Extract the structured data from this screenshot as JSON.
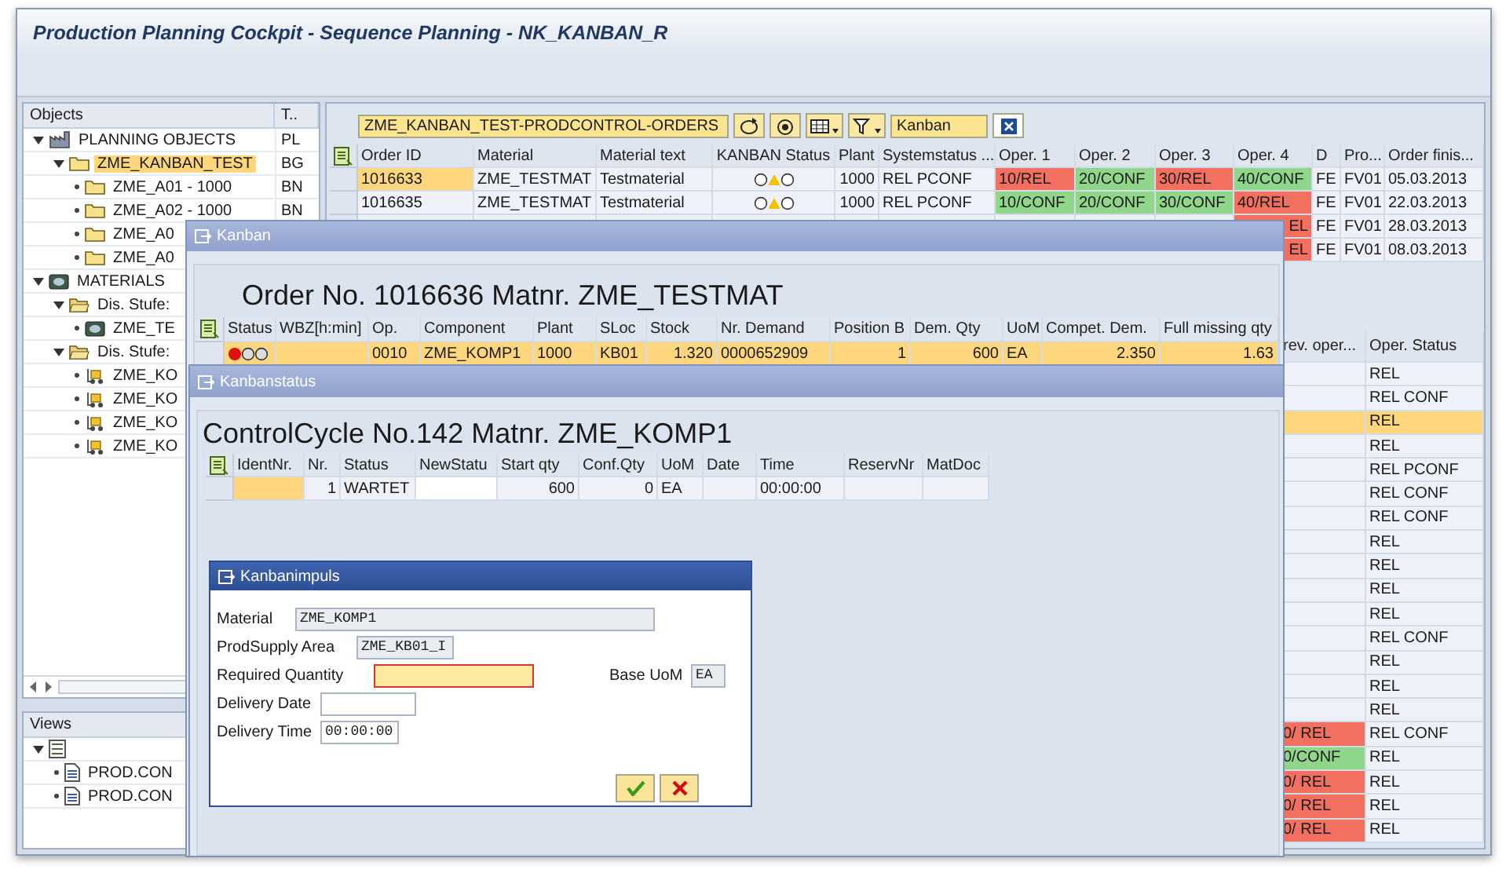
{
  "window": {
    "title": "Production Planning Cockpit - Sequence Planning - NK_KANBAN_R"
  },
  "objects_panel": {
    "columns": [
      "Objects",
      "T.."
    ],
    "tree": [
      {
        "kind": "plant",
        "label": "PLANNING OBJECTS",
        "type": "PL",
        "expanded": true,
        "selected": false,
        "children": [
          {
            "kind": "folder",
            "label": "ZME_KANBAN_TEST",
            "type": "BG",
            "expanded": true,
            "selected": true,
            "children": [
              {
                "kind": "folder",
                "label": "ZME_A01 - 1000",
                "type": "BN",
                "selected": false
              },
              {
                "kind": "folder",
                "label": "ZME_A02 - 1000",
                "type": "BN",
                "selected": false
              },
              {
                "kind": "folder",
                "label": "ZME_A0",
                "selected": false
              },
              {
                "kind": "folder",
                "label": "ZME_A0",
                "selected": false
              }
            ]
          }
        ]
      },
      {
        "kind": "material",
        "label": "MATERIALS",
        "expanded": true,
        "selected": false,
        "children": [
          {
            "kind": "open-folder",
            "label": "Dis. Stufe:",
            "expanded": true,
            "selected": false,
            "children": [
              {
                "kind": "material",
                "label": "ZME_TE",
                "selected": false
              }
            ]
          },
          {
            "kind": "open-folder",
            "label": "Dis. Stufe:",
            "expanded": true,
            "selected": false,
            "children": [
              {
                "kind": "part",
                "label": "ZME_KO",
                "selected": false
              },
              {
                "kind": "part",
                "label": "ZME_KO",
                "selected": false
              },
              {
                "kind": "part",
                "label": "ZME_KO",
                "selected": false
              },
              {
                "kind": "part",
                "label": "ZME_KO",
                "selected": false
              }
            ]
          }
        ]
      }
    ]
  },
  "views_panel": {
    "title": "Views",
    "tree": [
      {
        "kind": "list",
        "expanded": true,
        "children": [
          {
            "kind": "document",
            "label": "PROD.CON",
            "selected": false
          },
          {
            "kind": "document",
            "label": "PROD.CON",
            "selected": false
          }
        ]
      }
    ]
  },
  "orders_toolbar": {
    "variant": "ZME_KANBAN_TEST-PRODCONTROL-ORDERS",
    "layout": "Kanban"
  },
  "orders_table": {
    "columns": [
      "Order ID",
      "Material",
      "Material text",
      "KANBAN Status",
      "Plant",
      "Systemstatus ...",
      "Oper. 1",
      "Oper. 2",
      "Oper. 3",
      "Oper. 4",
      "D",
      "Pro...",
      "Order finis..."
    ],
    "rows": [
      {
        "selected": true,
        "order_id": "1016633",
        "material": "ZME_TESTMAT",
        "material_text": "Testmaterial",
        "light": {
          "kind": "yellow",
          "color": "#f2c200"
        },
        "plant": "1000",
        "system_status": "REL PCONF",
        "oper_1": {
          "text": "10/REL",
          "color": "#f2705f"
        },
        "oper_2": {
          "text": "20/CONF",
          "color": "#8fd68a"
        },
        "oper_3": {
          "text": "30/REL",
          "color": "#f2705f"
        },
        "oper_4": {
          "text": "40/CONF",
          "color": "#8fd68a"
        },
        "d": "FE",
        "pro": "FV01",
        "finish": "05.03.2013"
      },
      {
        "selected": false,
        "order_id": "1016635",
        "material": "ZME_TESTMAT",
        "material_text": "Testmaterial",
        "light": {
          "kind": "yellow",
          "color": "#f2c200"
        },
        "plant": "1000",
        "system_status": "REL PCONF",
        "oper_1": {
          "text": "10/CONF",
          "color": "#8fd68a"
        },
        "oper_2": {
          "text": "20/CONF",
          "color": "#8fd68a"
        },
        "oper_3": {
          "text": "30/CONF",
          "color": "#8fd68a"
        },
        "oper_4": {
          "text": "40/REL",
          "color": "#f2705f"
        },
        "d": "FE",
        "pro": "FV01",
        "finish": "22.03.2013"
      },
      {
        "oper_4": {
          "text": "EL",
          "color": "#f2705f"
        },
        "d": "FE",
        "pro": "FV01",
        "finish": "28.03.2013"
      },
      {
        "oper_4": {
          "text": "EL",
          "color": "#f2705f"
        },
        "d": "FE",
        "pro": "FV01",
        "finish": "08.03.2013"
      }
    ]
  },
  "operations_table": {
    "columns": [
      "rev. oper...",
      "Oper. Status"
    ],
    "rows": [
      {
        "status": "REL",
        "selected": false
      },
      {
        "status": "REL CONF",
        "selected": false
      },
      {
        "status": "REL",
        "selected": true
      },
      {
        "status": "REL",
        "selected": false
      },
      {
        "status": "REL PCONF",
        "selected": false
      },
      {
        "status": "REL CONF",
        "selected": false
      },
      {
        "status": "REL CONF",
        "selected": false
      },
      {
        "status": "REL",
        "selected": false
      },
      {
        "status": "REL",
        "selected": false
      },
      {
        "status": "REL",
        "selected": false
      },
      {
        "status": "REL",
        "selected": false
      },
      {
        "status": "REL CONF",
        "selected": false
      },
      {
        "status": "REL",
        "selected": false
      },
      {
        "status": "REL",
        "selected": false
      },
      {
        "status": "REL",
        "selected": false
      },
      {
        "prev": {
          "text": "0/ REL",
          "color": "#f2705f"
        },
        "status": "REL CONF",
        "selected": false
      },
      {
        "prev": {
          "text": "0/CONF",
          "color": "#8fd68a"
        },
        "status": "REL",
        "selected": false
      },
      {
        "prev": {
          "text": "0/ REL",
          "color": "#f2705f"
        },
        "status": "REL",
        "selected": false
      },
      {
        "prev": {
          "text": "0/ REL",
          "color": "#f2705f"
        },
        "status": "REL",
        "selected": false
      },
      {
        "prev": {
          "text": "0/ REL",
          "color": "#f2705f"
        },
        "status": "REL",
        "selected": false
      }
    ]
  },
  "kanban_dialog": {
    "title": "Kanban",
    "heading": "Order No. 1016636 Matnr. ZME_TESTMAT",
    "columns": [
      "Status",
      "WBZ[h:min]",
      "Op.",
      "Component",
      "Plant",
      "SLoc",
      "Stock",
      "Nr. Demand",
      "Position B",
      "Dem. Qty",
      "UoM",
      "Compet. Dem.",
      "Full missing qty"
    ],
    "rows": [
      {
        "selected": true,
        "light": {
          "kind": "red",
          "color": "#e01010"
        },
        "cells": [
          "",
          "",
          "0010",
          "ZME_KOMP1",
          "1000",
          "KB01",
          "1.320",
          "0000652909",
          "1",
          "600",
          "EA",
          "2.350",
          "1.63"
        ]
      }
    ]
  },
  "kanbanstatus_dialog": {
    "title": "Kanbanstatus",
    "heading": "ControlCycle No.142 Matnr. ZME_KOMP1",
    "columns": [
      "IdentNr.",
      "Nr.",
      "Status",
      "NewStatu",
      "Start qty",
      "Conf.Qty",
      "UoM",
      "Date",
      "Time",
      "ReservNr",
      "MatDoc"
    ],
    "rows": [
      {
        "nr": "1",
        "status": "WARTET",
        "start_qty": "600",
        "conf_qty": "0",
        "uom": "EA",
        "time": "00:00:00"
      }
    ]
  },
  "impulse_dialog": {
    "title": "Kanbanimpuls",
    "material_label": "Material",
    "material": "ZME_KOMP1",
    "area_label": "ProdSupply Area",
    "area": "ZME_KB01_I",
    "qty_label": "Required Quantity",
    "uom_label": "Base UoM",
    "uom": "EA",
    "date_label": "Delivery Date",
    "time_label": "Delivery Time",
    "time": "00:00:00"
  }
}
